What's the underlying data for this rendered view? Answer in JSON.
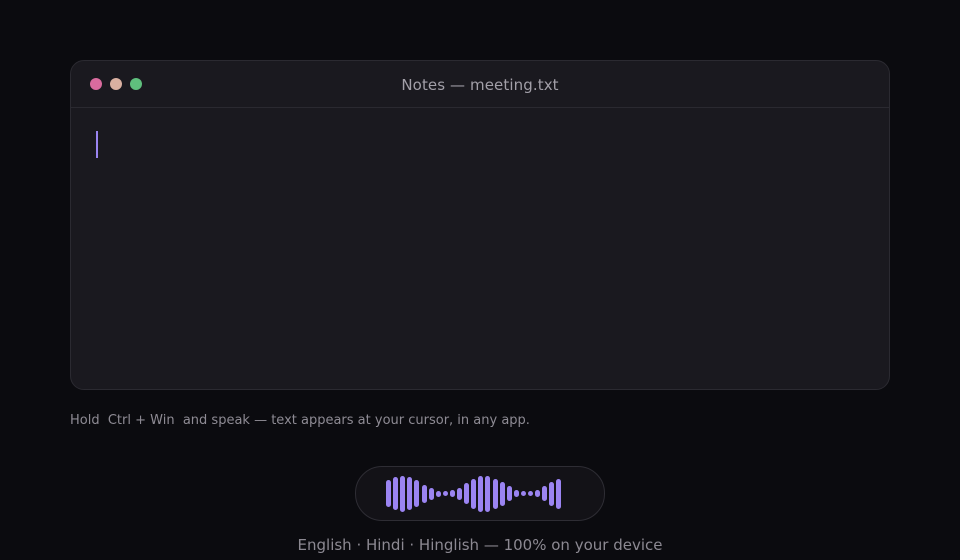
{
  "window": {
    "title": "Notes — meeting.txt",
    "controls": [
      "close",
      "minimize",
      "maximize"
    ],
    "editor_text": ""
  },
  "hint": {
    "text": "Hold  Ctrl + Win  and speak — text appears at your cursor, in any app."
  },
  "waveform": {
    "color": "#9b84f2",
    "levels": [
      0.45,
      0.55,
      0.6,
      0.55,
      0.45,
      0.3,
      0.2,
      0.1,
      0.08,
      0.12,
      0.2,
      0.35,
      0.5,
      0.6,
      0.6,
      0.5,
      0.4,
      0.25,
      0.12,
      0.08,
      0.08,
      0.12,
      0.25,
      0.4,
      0.5
    ]
  },
  "footer": {
    "text": "English · Hindi · Hinglish — 100% on your device"
  },
  "colors": {
    "background": "#0b0b0f",
    "window": "#1a191f",
    "caret": "#9a84f0",
    "close": "#d96b9e",
    "minimize": "#d9b0a1",
    "maximize": "#5fbf7d"
  }
}
